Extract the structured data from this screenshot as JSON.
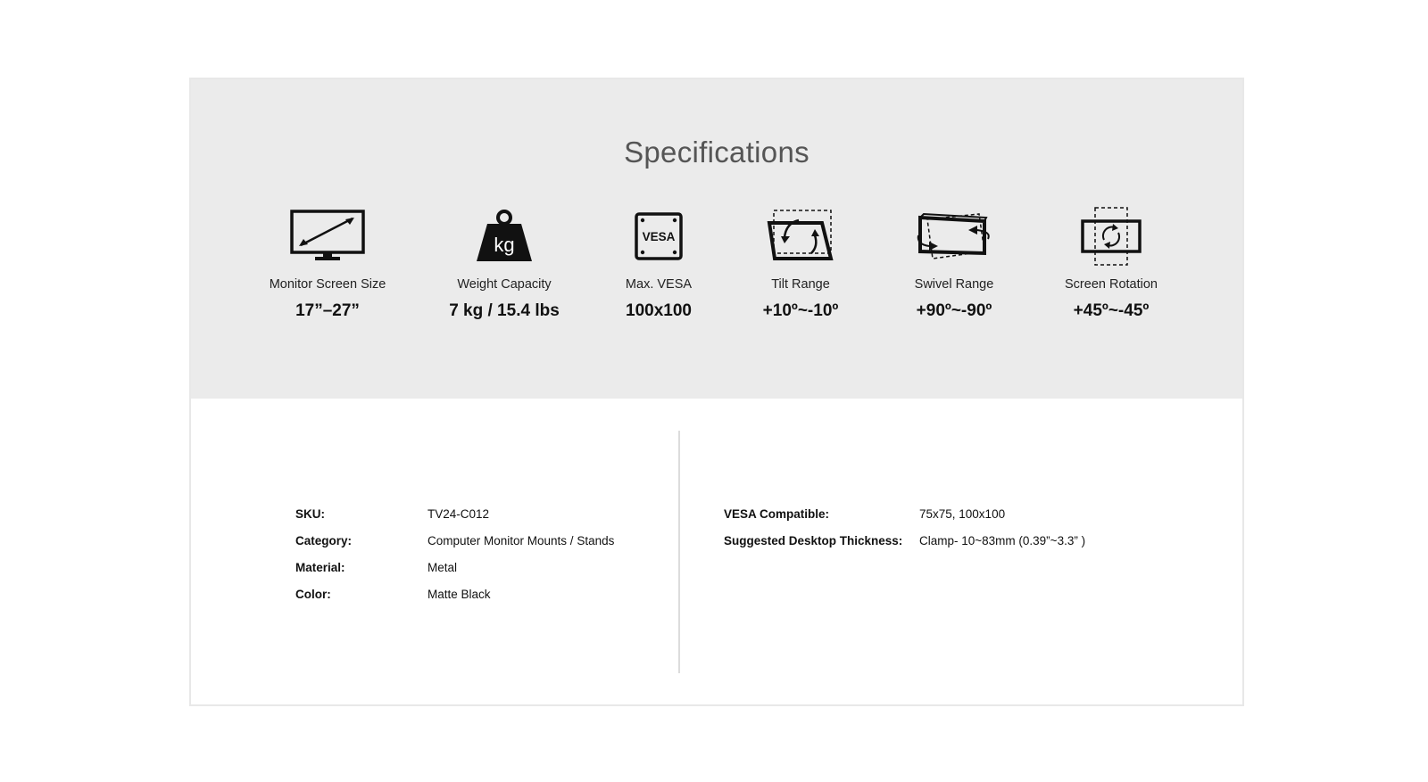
{
  "title": "Specifications",
  "specs": [
    {
      "label": "Monitor Screen Size",
      "value": "17”–27”",
      "icon": "monitor-icon"
    },
    {
      "label": "Weight Capacity",
      "value": "7 kg / 15.4 lbs",
      "icon": "kg-weight-icon",
      "icon_text": "kg"
    },
    {
      "label": "Max. VESA",
      "value": "100x100",
      "icon": "vesa-icon",
      "icon_text": "VESA"
    },
    {
      "label": "Tilt Range",
      "value": "+10º~-10º",
      "icon": "tilt-icon"
    },
    {
      "label": "Swivel Range",
      "value": "+90º~-90º",
      "icon": "swivel-icon"
    },
    {
      "label": "Screen Rotation",
      "value": "+45º~-45º",
      "icon": "rotation-icon"
    }
  ],
  "details_left": [
    {
      "key": "SKU:",
      "value": "TV24-C012"
    },
    {
      "key": "Category:",
      "value": "Computer Monitor Mounts / Stands"
    },
    {
      "key": "Material:",
      "value": "Metal"
    },
    {
      "key": "Color:",
      "value": "Matte Black"
    }
  ],
  "details_right": [
    {
      "key": "VESA Compatible:",
      "value": "75x75, 100x100"
    },
    {
      "key": "Suggested Desktop Thickness:",
      "value": "Clamp- 10~83mm (0.39”~3.3” )"
    }
  ]
}
